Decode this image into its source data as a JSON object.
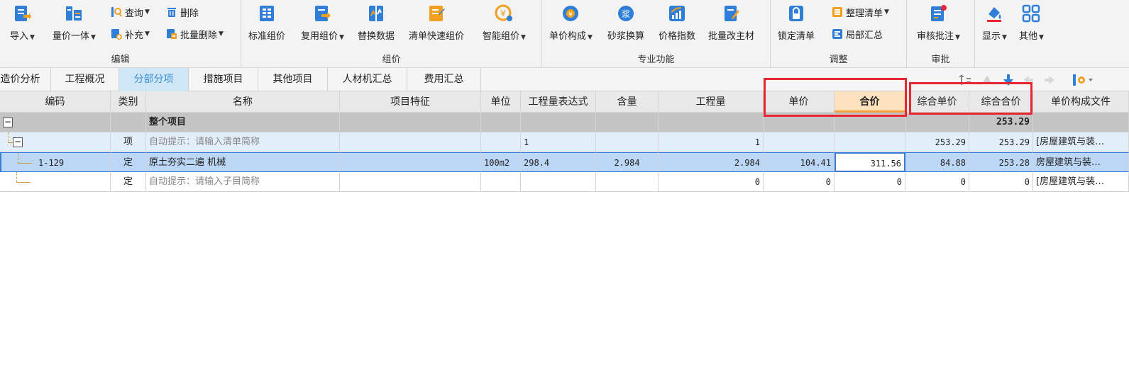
{
  "ribbon": {
    "edit": {
      "label": "编辑",
      "import": "导入",
      "qty_price": "量价一体",
      "query": "查询",
      "delete": "删除",
      "supplement": "补充",
      "batch_delete": "批量删除"
    },
    "pricing": {
      "label": "组价",
      "standard": "标准组价",
      "reuse": "复用组价",
      "replace": "替换数据",
      "quick": "清单快速组价",
      "smart": "智能组价"
    },
    "special": {
      "label": "专业功能",
      "unit_price_comp": "单价构成",
      "mortar": "砂浆换算",
      "price_index": "价格指数",
      "batch_main": "批量改主材"
    },
    "adjust": {
      "label": "调整",
      "lock": "锁定清单",
      "organize": "整理清单",
      "partial": "局部汇总"
    },
    "review": {
      "label": "审批",
      "annotate": "审核批注"
    },
    "view": {
      "display": "显示",
      "other": "其他"
    }
  },
  "tabs": [
    {
      "label": "造价分析"
    },
    {
      "label": "工程概况"
    },
    {
      "label": "分部分项"
    },
    {
      "label": "措施项目"
    },
    {
      "label": "其他项目"
    },
    {
      "label": "人材机汇总"
    },
    {
      "label": "费用汇总"
    }
  ],
  "columns": [
    "编码",
    "类别",
    "名称",
    "项目特征",
    "单位",
    "工程量表达式",
    "含量",
    "工程量",
    "单价",
    "合价",
    "综合单价",
    "综合合价",
    "单价构成文件"
  ],
  "rows": {
    "total": {
      "expander": "−",
      "name": "整个项目",
      "comp_total": "253.29"
    },
    "item": {
      "expander": "−",
      "type": "项",
      "name": "自动提示：请输入清单简称",
      "expr": "1",
      "qty": "1",
      "comp_unit": "253.29",
      "comp_total": "253.29",
      "file": "[房屋建筑与装…"
    },
    "selected": {
      "code": "1-129",
      "type": "定",
      "name": "原土夯实二遍 机械",
      "unit": "100m2",
      "expr": "298.4",
      "content": "2.984",
      "qty": "2.984",
      "price": "104.41",
      "total": "311.56",
      "comp_unit": "84.88",
      "comp_total": "253.28",
      "file": "房屋建筑与装…"
    },
    "blank": {
      "type": "定",
      "name": "自动提示：请输入子目简称",
      "qty": "0",
      "price": "0",
      "total": "0",
      "comp_unit": "0",
      "comp_total": "0",
      "file": "[房屋建筑与装…"
    }
  },
  "colors": {
    "accent": "#3a8fd6",
    "highlight_box": "#e8262f",
    "icon_blue": "#2f7fd8",
    "icon_orange": "#f0a020"
  }
}
